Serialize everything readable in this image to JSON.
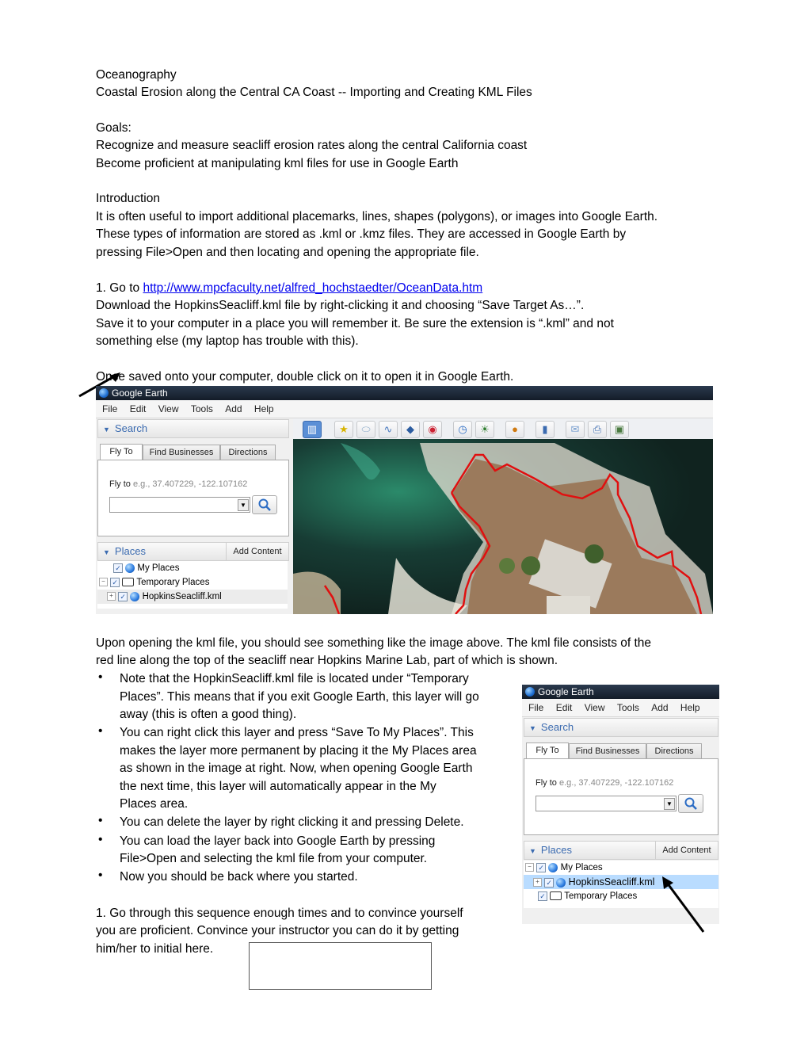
{
  "document": {
    "course": "Oceanography",
    "title": "Coastal Erosion along the Central CA Coast  --  Importing and Creating KML Files",
    "goals_heading": "Goals:",
    "goals": [
      "Recognize and measure seacliff erosion rates along the central California coast",
      "Become proficient at manipulating kml files for use in Google Earth"
    ],
    "intro_heading": "Introduction",
    "intro_lines": [
      "It is often useful to import additional placemarks, lines, shapes (polygons), or images into Google Earth.",
      "These types of information are stored as .kml or .kmz files. They are accessed in Google Earth by",
      "pressing File>Open and then locating and opening the appropriate file."
    ],
    "step1_prefix": "1. Go to ",
    "step1_link": "http://www.mpcfaculty.net/alfred_hochstaedter/OceanData.htm",
    "step1_lines": [
      "Download the HopkinsSeacliff.kml file by right-clicking it and choosing “Save Target As…”.",
      "Save it to your computer in a place you will remember it. Be sure the extension is “.kml” and not",
      "something else (my laptop has trouble with this)."
    ],
    "open_line": "Once saved onto your computer, double click on it to open it in Google Earth.",
    "after_lines": [
      "Upon opening the kml file, you should see something like the image above. The kml file consists of the",
      "red line along the top of the seacliff near Hopkins Marine Lab, part of which is shown."
    ],
    "bullets": [
      [
        "Note that the HopkinSeacliff.kml file is located under “Temporary",
        "Places”. This means that if you exit Google Earth, this layer will go",
        "away (this is often a good thing)."
      ],
      [
        "You can right click this layer and press “Save To My Places”. This",
        "makes the layer more permanent by placing it the My Places area",
        "as shown in the image at right. Now, when opening Google Earth",
        "the next time, this layer will automatically appear in the My",
        "Places area."
      ],
      [
        "You can delete the layer by right clicking it and pressing Delete."
      ],
      [
        "You can load the layer back into Google Earth by pressing",
        "File>Open and selecting the kml file from your computer."
      ],
      [
        "Now you should be back where you started."
      ]
    ],
    "final_lines": [
      "1. Go through this sequence enough times and to convince yourself",
      "you are proficient. Convince your instructor you can do it by getting",
      "him/her to initial here."
    ]
  },
  "google_earth": {
    "app_title": "Google Earth",
    "menu": [
      "File",
      "Edit",
      "View",
      "Tools",
      "Add",
      "Help"
    ],
    "search_heading": "Search",
    "tabs": [
      "Fly To",
      "Find Businesses",
      "Directions"
    ],
    "fly_label": "Fly to",
    "fly_hint": "e.g., 37.407229, -122.107162",
    "fly_input_value": "",
    "places_heading": "Places",
    "add_content": "Add Content",
    "toolbar_icons": [
      "sidebar-icon",
      "placemark-icon",
      "polygon-icon",
      "path-icon",
      "overlay-icon",
      "tour-icon",
      "historical-imagery-icon",
      "sunlight-icon",
      "planets-icon",
      "ruler-icon",
      "email-icon",
      "print-icon",
      "save-image-icon"
    ],
    "tree1": [
      "My Places",
      "Temporary Places",
      "HopkinsSeacliff.kml"
    ],
    "tree2": [
      "My Places",
      "HopkinsSeacliff.kml",
      "Temporary Places"
    ]
  }
}
